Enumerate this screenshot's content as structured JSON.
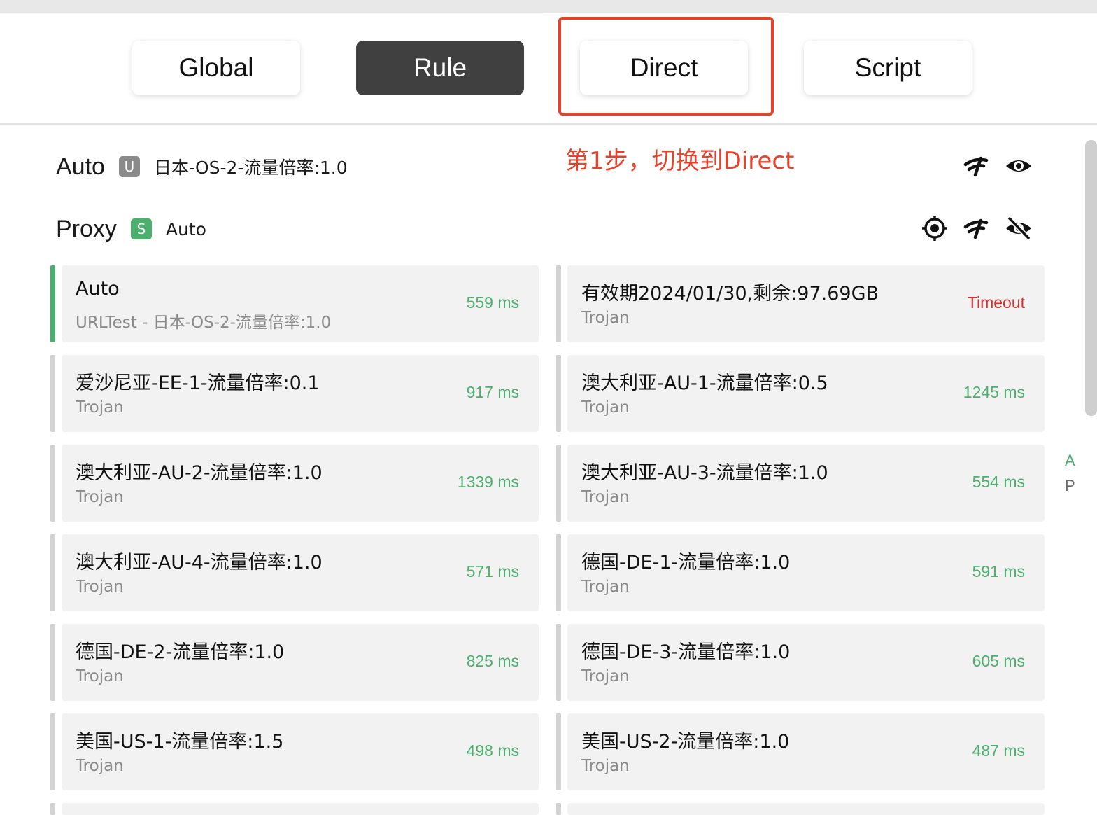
{
  "modes": [
    {
      "label": "Global",
      "active": false
    },
    {
      "label": "Rule",
      "active": true
    },
    {
      "label": "Direct",
      "active": false
    },
    {
      "label": "Script",
      "active": false
    }
  ],
  "annotation": {
    "text": "第1步，切换到Direct",
    "color": "#e8412a"
  },
  "groups": {
    "auto": {
      "name": "Auto",
      "badge": "U",
      "current": "日本-OS-2-流量倍率:1.0",
      "icons": [
        "speed-test-icon",
        "eye-icon"
      ]
    },
    "proxy": {
      "name": "Proxy",
      "badge": "S",
      "current": "Auto",
      "icons": [
        "locate-icon",
        "speed-test-icon",
        "eye-off-icon"
      ]
    }
  },
  "side_letters": {
    "a": "A",
    "p": "P"
  },
  "colors": {
    "accent_green": "#4caf6e",
    "timeout_red": "#d32f2f",
    "active_mode": "#404040"
  },
  "proxies": [
    {
      "name": "Auto",
      "type": "URLTest - 日本-OS-2-流量倍率:1.0",
      "delay": "559 ms",
      "selected": true
    },
    {
      "name": "有效期2024/01/30,剩余:97.69GB",
      "type": "Trojan",
      "delay": "Timeout",
      "selected": false
    },
    {
      "name": "爱沙尼亚-EE-1-流量倍率:0.1",
      "type": "Trojan",
      "delay": "917 ms",
      "selected": false
    },
    {
      "name": "澳大利亚-AU-1-流量倍率:0.5",
      "type": "Trojan",
      "delay": "1245 ms",
      "selected": false
    },
    {
      "name": "澳大利亚-AU-2-流量倍率:1.0",
      "type": "Trojan",
      "delay": "1339 ms",
      "selected": false
    },
    {
      "name": "澳大利亚-AU-3-流量倍率:1.0",
      "type": "Trojan",
      "delay": "554 ms",
      "selected": false
    },
    {
      "name": "澳大利亚-AU-4-流量倍率:1.0",
      "type": "Trojan",
      "delay": "571 ms",
      "selected": false
    },
    {
      "name": "德国-DE-1-流量倍率:1.0",
      "type": "Trojan",
      "delay": "591 ms",
      "selected": false
    },
    {
      "name": "德国-DE-2-流量倍率:1.0",
      "type": "Trojan",
      "delay": "825 ms",
      "selected": false
    },
    {
      "name": "德国-DE-3-流量倍率:1.0",
      "type": "Trojan",
      "delay": "605 ms",
      "selected": false
    },
    {
      "name": "美国-US-1-流量倍率:1.5",
      "type": "Trojan",
      "delay": "498 ms",
      "selected": false
    },
    {
      "name": "美国-US-2-流量倍率:1.0",
      "type": "Trojan",
      "delay": "487 ms",
      "selected": false
    }
  ]
}
